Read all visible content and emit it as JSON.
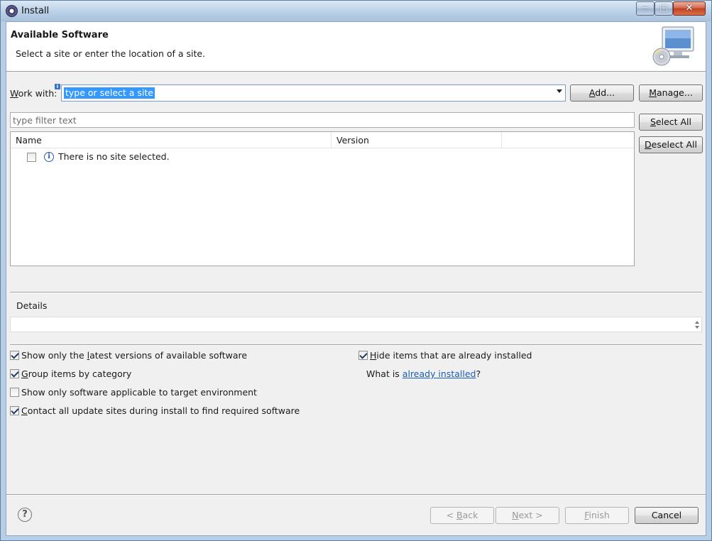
{
  "window": {
    "title": "Install",
    "controls": {
      "minimize": "─",
      "maximize": "□",
      "close": "✕"
    }
  },
  "banner": {
    "title": "Available Software",
    "subtitle": "Select a site or enter the location of a site.",
    "image_icon": "computer-cd-icon"
  },
  "work_with": {
    "label_mn": "W",
    "label_rest": "ork with:",
    "value": "type or select a site",
    "add_mn": "A",
    "add_rest": "dd...",
    "manage_mn": "M",
    "manage_rest": "anage..."
  },
  "filter": {
    "placeholder": "type filter text"
  },
  "table": {
    "columns": [
      "Name",
      "Version"
    ],
    "rows": [
      {
        "name": "There is no site selected.",
        "checked": false,
        "icon": "info-icon"
      }
    ]
  },
  "side_buttons": {
    "select_all_mn": "S",
    "select_all_rest": "elect All",
    "deselect_all_mn": "D",
    "deselect_all_rest": "eselect All"
  },
  "details": {
    "label": "Details"
  },
  "options": {
    "latest_pre": "Show only the ",
    "latest_mn": "l",
    "latest_post": "atest versions of available software",
    "latest_checked": true,
    "group_mn": "G",
    "group_rest": "roup items by category",
    "group_checked": true,
    "target": "Show only software applicable to target environment",
    "target_checked": false,
    "contact_mn": "C",
    "contact_rest": "ontact all update sites during install to find required software",
    "contact_checked": true,
    "hide_mn": "H",
    "hide_rest": "ide items that are already installed",
    "hide_checked": true,
    "what_is": "What is ",
    "link": "already installed",
    "q": "?"
  },
  "footer": {
    "back_pre": "< ",
    "back_mn": "B",
    "back_rest": "ack",
    "next_mn": "N",
    "next_rest": "ext >",
    "finish_mn": "F",
    "finish_rest": "inish",
    "cancel": "Cancel",
    "help": "?"
  }
}
